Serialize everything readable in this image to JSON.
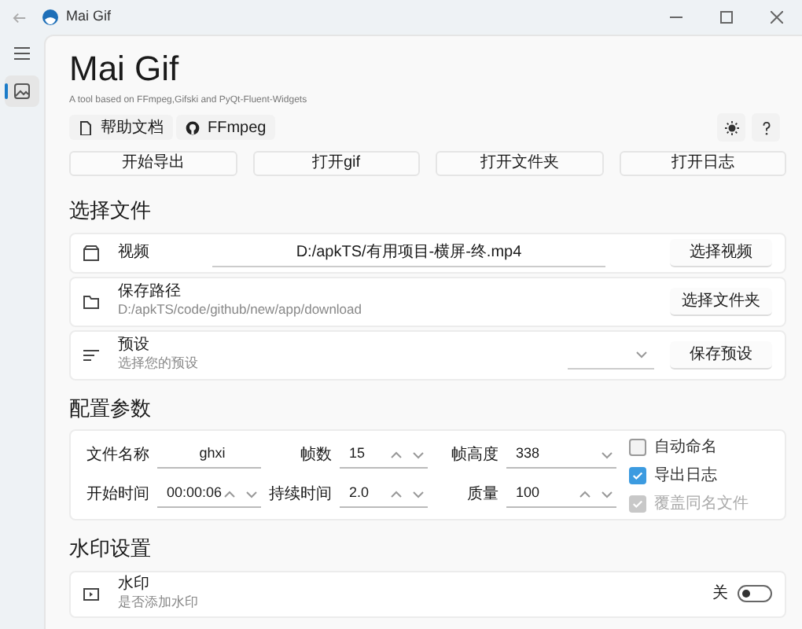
{
  "window": {
    "title": "Mai Gif"
  },
  "nav": [
    {
      "kind": "menu",
      "selected": false
    },
    {
      "kind": "image",
      "selected": true
    }
  ],
  "header": {
    "title": "Mai Gif",
    "subtitle": "A tool based on FFmpeg,Gifski and PyQt-Fluent-Widgets",
    "links": [
      {
        "kind": "doc",
        "label": "帮助文档"
      },
      {
        "kind": "github",
        "label": "FFmpeg"
      }
    ],
    "tools": [
      {
        "kind": "theme"
      },
      {
        "kind": "help"
      }
    ]
  },
  "actions": [
    "开始导出",
    "打开gif",
    "打开文件夹",
    "打开日志"
  ],
  "files": {
    "title": "选择文件",
    "rows": [
      {
        "kind": "video",
        "label": "视频",
        "value": "D:/apkTS/有用项目-横屏-终.mp4",
        "button": "选择视频"
      },
      {
        "kind": "folder",
        "label": "保存路径",
        "subtitle": "D:/apkTS/code/github/new/app/download",
        "button": "选择文件夹"
      },
      {
        "kind": "preset",
        "label": "预设",
        "subtitle": "选择您的预设",
        "button": "保存预设"
      }
    ]
  },
  "config": {
    "title": "配置参数",
    "fields": [
      {
        "label": "文件名称",
        "value": "ghxi",
        "kind": "text"
      },
      {
        "label": "帧数",
        "value": "15",
        "kind": "spin"
      },
      {
        "label": "帧高度",
        "value": "338",
        "kind": "combo"
      },
      {
        "label": "开始时间",
        "value": "00:00:06",
        "kind": "spin"
      },
      {
        "label": "持续时间",
        "value": "2.0",
        "kind": "spin"
      },
      {
        "label": "质量",
        "value": "100",
        "kind": "spin"
      }
    ],
    "checkboxes": [
      {
        "label": "自动命名",
        "checked": false,
        "disabled": false
      },
      {
        "label": "导出日志",
        "checked": true,
        "disabled": false
      },
      {
        "label": "覆盖同名文件",
        "checked": true,
        "disabled": true
      }
    ]
  },
  "watermark": {
    "title": "水印设置",
    "label": "水印",
    "subtitle": "是否添加水印",
    "switch_label": "关",
    "on": false
  }
}
